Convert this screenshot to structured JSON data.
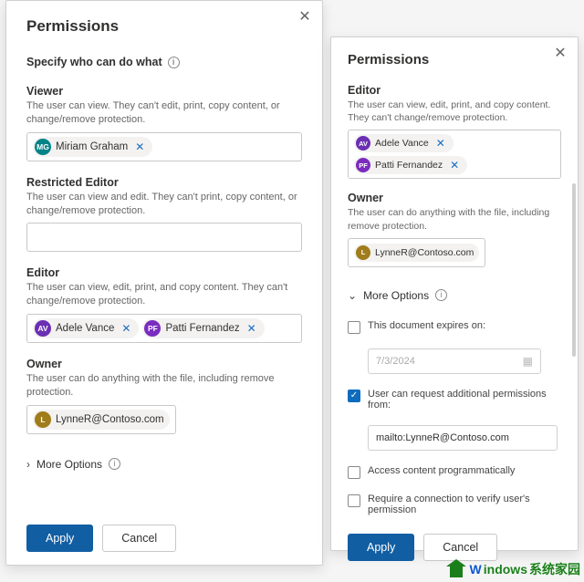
{
  "colors": {
    "mg": "#038387",
    "av": "#6b2fb3",
    "pf": "#7b2cbf",
    "l": "#a07c1a",
    "primary": "#115ea3"
  },
  "left": {
    "title": "Permissions",
    "specify": "Specify who can do what",
    "viewer": {
      "title": "Viewer",
      "desc": "The user can view. They can't edit, print, copy content, or change/remove protection.",
      "chips": [
        {
          "initials": "MG",
          "name": "Miriam Graham",
          "color": "#038387"
        }
      ]
    },
    "restricted": {
      "title": "Restricted Editor",
      "desc": "The user can view and edit. They can't print, copy content, or change/remove protection."
    },
    "editor": {
      "title": "Editor",
      "desc": "The user can view, edit, print, and copy content. They can't change/remove protection.",
      "chips": [
        {
          "initials": "AV",
          "name": "Adele Vance",
          "color": "#6b2fb3"
        },
        {
          "initials": "PF",
          "name": "Patti Fernandez",
          "color": "#7b2cbf"
        }
      ]
    },
    "owner": {
      "title": "Owner",
      "desc": "The user can do anything with the file, including remove protection.",
      "chips": [
        {
          "initials": "L",
          "name": "LynneR@Contoso.com",
          "color": "#a07c1a"
        }
      ]
    },
    "more_options": "More Options",
    "apply": "Apply",
    "cancel": "Cancel"
  },
  "right": {
    "title": "Permissions",
    "editor": {
      "title": "Editor",
      "desc": "The user can view, edit, print, and copy content. They can't change/remove protection.",
      "chips": [
        {
          "initials": "AV",
          "name": "Adele Vance",
          "color": "#6b2fb3"
        },
        {
          "initials": "PF",
          "name": "Patti Fernandez",
          "color": "#7b2cbf"
        }
      ]
    },
    "owner": {
      "title": "Owner",
      "desc": "The user can do anything with the file, including remove protection.",
      "chips": [
        {
          "initials": "L",
          "name": "LynneR@Contoso.com",
          "color": "#a07c1a"
        }
      ]
    },
    "more_options": "More Options",
    "opt_expires": "This document expires on:",
    "opt_expires_date": "7/3/2024",
    "opt_request": "User can request additional permissions from:",
    "opt_request_value": "mailto:LynneR@Contoso.com",
    "opt_programmatic": "Access content programmatically",
    "opt_connection": "Require a connection to verify user's permission",
    "apply": "Apply",
    "cancel": "Cancel"
  },
  "watermark": {
    "brand1": "W",
    "brand2": "indows",
    "brand3": "系统家园"
  }
}
